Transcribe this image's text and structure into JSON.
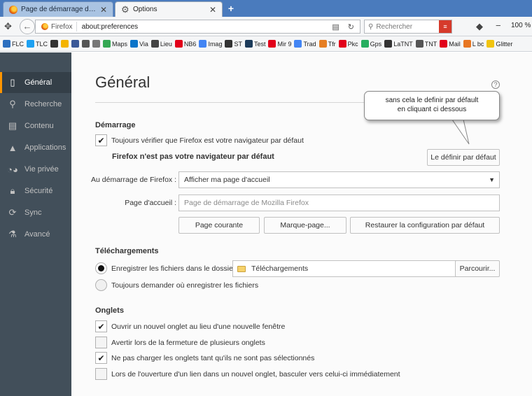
{
  "tabs": [
    {
      "title": "Page de démarrage de Mozilla Fi...",
      "icon": "firefox-icon",
      "active": false
    },
    {
      "title": "Options",
      "icon": "gear-icon",
      "active": true
    }
  ],
  "new_tab_label": "+",
  "navbar": {
    "identity_label": "Firefox",
    "url": "about:preferences",
    "search_placeholder": "Rechercher",
    "zoom": "100 %"
  },
  "bookmarks": [
    {
      "label": "FLC",
      "color": "#2c6fbf"
    },
    {
      "label": "TLC",
      "color": "#1da1f2"
    },
    {
      "label": "",
      "color": "#333333"
    },
    {
      "label": "",
      "color": "#f4b400"
    },
    {
      "label": "",
      "color": "#3b5998"
    },
    {
      "label": "",
      "color": "#555555"
    },
    {
      "label": "",
      "color": "#777777"
    },
    {
      "label": "Maps",
      "color": "#34a853"
    },
    {
      "label": "Via",
      "color": "#0a74c9"
    },
    {
      "label": "Lieu",
      "color": "#444444"
    },
    {
      "label": "NB6",
      "color": "#e2001a"
    },
    {
      "label": "Imag",
      "color": "#4285f4"
    },
    {
      "label": "ST",
      "color": "#333333"
    },
    {
      "label": "Test",
      "color": "#1c3b5a"
    },
    {
      "label": "Mir 9",
      "color": "#e2001a"
    },
    {
      "label": "Trad",
      "color": "#4285f4"
    },
    {
      "label": "Tfr",
      "color": "#e67e22"
    },
    {
      "label": "Pkc",
      "color": "#e2001a"
    },
    {
      "label": "Gps",
      "color": "#27ae60"
    },
    {
      "label": "LaTNT",
      "color": "#333333"
    },
    {
      "label": "TNT",
      "color": "#555555"
    },
    {
      "label": "Mail",
      "color": "#e2001a"
    },
    {
      "label": "L bc",
      "color": "#e87722"
    },
    {
      "label": "Glitter",
      "color": "#f1c40f"
    }
  ],
  "sidebar": {
    "items": [
      {
        "label": "Général",
        "icon": "general-icon"
      },
      {
        "label": "Recherche",
        "icon": "search-icon"
      },
      {
        "label": "Contenu",
        "icon": "content-icon"
      },
      {
        "label": "Applications",
        "icon": "applications-icon"
      },
      {
        "label": "Vie privée",
        "icon": "privacy-mask-icon"
      },
      {
        "label": "Sécurité",
        "icon": "lock-icon"
      },
      {
        "label": "Sync",
        "icon": "sync-icon"
      },
      {
        "label": "Avancé",
        "icon": "advanced-icon"
      }
    ],
    "selected": "Général"
  },
  "page": {
    "title": "Général",
    "help": "?"
  },
  "startup": {
    "heading": "Démarrage",
    "check_default_label": "Toujours vérifier que Firefox est votre navigateur par défaut",
    "check_default_checked": true,
    "not_default_text": "Firefox n'est pas votre navigateur par défaut",
    "make_default_button": "Le définir par défaut",
    "on_startup_label": "Au démarrage de Firefox :",
    "on_startup_value": "Afficher ma page d'accueil",
    "homepage_label": "Page d'accueil :",
    "homepage_placeholder": "Page de démarrage de Mozilla Firefox",
    "current_page_button": "Page courante",
    "bookmark_button": "Marque-page...",
    "restore_default_button": "Restaurer la configuration par défaut"
  },
  "downloads": {
    "heading": "Téléchargements",
    "save_to_label": "Enregistrer les fichiers dans le dossier",
    "save_to_selected": true,
    "folder_name": "Téléchargements",
    "browse_button": "Parcourir...",
    "always_ask_label": "Toujours demander où enregistrer les fichiers"
  },
  "tabs_section": {
    "heading": "Onglets",
    "options": [
      {
        "label": "Ouvrir un nouvel onglet au lieu d'une nouvelle fenêtre",
        "checked": true
      },
      {
        "label": "Avertir lors de la fermeture de plusieurs onglets",
        "checked": false
      },
      {
        "label": "Ne pas charger les onglets tant qu'ils ne sont pas sélectionnés",
        "checked": true
      },
      {
        "label": "Lors de l'ouverture d'un lien dans un nouvel onglet, basculer vers celui-ci immédiatement",
        "checked": false
      }
    ]
  },
  "annotation": {
    "line1": "sans cela le definir par défault",
    "line2": "en cliquant ci dessous"
  },
  "colors": {
    "tabstrip": "#4a7bbd",
    "sidebar": "#424f5a",
    "sidebar_selected": "#343f48",
    "accent": "#ff9500"
  }
}
